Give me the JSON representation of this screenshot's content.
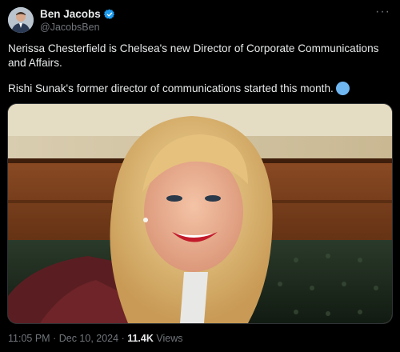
{
  "tweet": {
    "author": {
      "display_name": "Ben Jacobs",
      "handle": "@JacobsBen"
    },
    "more_label": "···",
    "text_line1": "Nerissa Chesterfield is Chelsea's new Director of Corporate Communications and Affairs.",
    "text_line2": "Rishi Sunak's former director of communications started this month.",
    "time": "11:05 PM",
    "sep": "·",
    "date": "Dec 10, 2024",
    "views_count": "11.4K",
    "views_label": "Views"
  },
  "colors": {
    "background": "#000000",
    "text_primary": "#e7e9ea",
    "text_secondary": "#71767b",
    "verified": "#1d9bf0"
  },
  "icons": {
    "verified": "verified-badge-icon",
    "more": "more-options-icon"
  }
}
